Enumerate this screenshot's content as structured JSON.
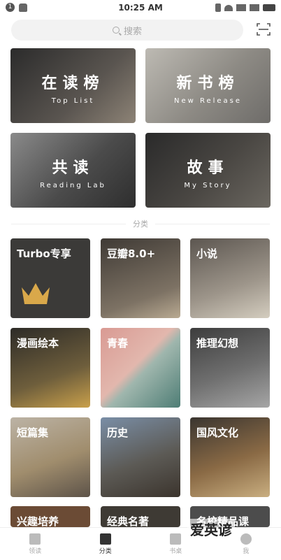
{
  "status_bar": {
    "time": "10:25 AM",
    "notification_count": "1"
  },
  "search": {
    "placeholder": "搜索"
  },
  "featured": [
    {
      "title": "在读榜",
      "subtitle": "Top List"
    },
    {
      "title": "新书榜",
      "subtitle": "New Release"
    },
    {
      "title": "共读",
      "subtitle": "Reading Lab"
    },
    {
      "title": "故事",
      "subtitle": "My Story"
    }
  ],
  "section_label": "分类",
  "categories": [
    "Turbo专享",
    "豆瓣8.0+",
    "小说",
    "漫画绘本",
    "青春",
    "推理幻想",
    "短篇集",
    "历史",
    "国风文化",
    "兴趣培养",
    "经典名著",
    "名校精品课"
  ],
  "bottom_nav": [
    {
      "label": "领读",
      "active": false
    },
    {
      "label": "分类",
      "active": true
    },
    {
      "label": "书桌",
      "active": false
    },
    {
      "label": "我",
      "active": false
    }
  ],
  "watermark": "爱英谚",
  "colors": {
    "accent": "#333333",
    "inactive": "#aaaaaa"
  }
}
